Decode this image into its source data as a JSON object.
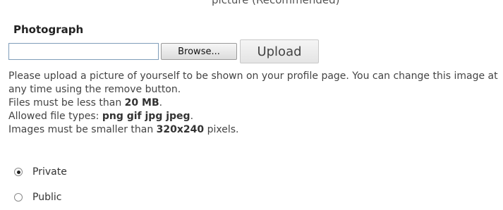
{
  "form": {
    "section_title": "Photograph",
    "file_path_value": "",
    "browse_label": "Browse...",
    "upload_label": "Upload",
    "description": {
      "line1": "Please upload a picture of yourself to be shown on your profile page. You can change this image at any time using the remove button.",
      "size_prefix": "Files must be less than ",
      "size_value": "20 MB",
      "size_suffix": ".",
      "types_prefix": "Allowed file types: ",
      "types_value": "png gif jpg jpeg",
      "types_suffix": ".",
      "dims_prefix": "Images must be smaller than ",
      "dims_value": "320x240",
      "dims_suffix": " pixels."
    },
    "visibility": {
      "selected": "Private",
      "options": [
        "Private",
        "Public"
      ]
    }
  },
  "cropped_top_text": "picture (Recommended)"
}
